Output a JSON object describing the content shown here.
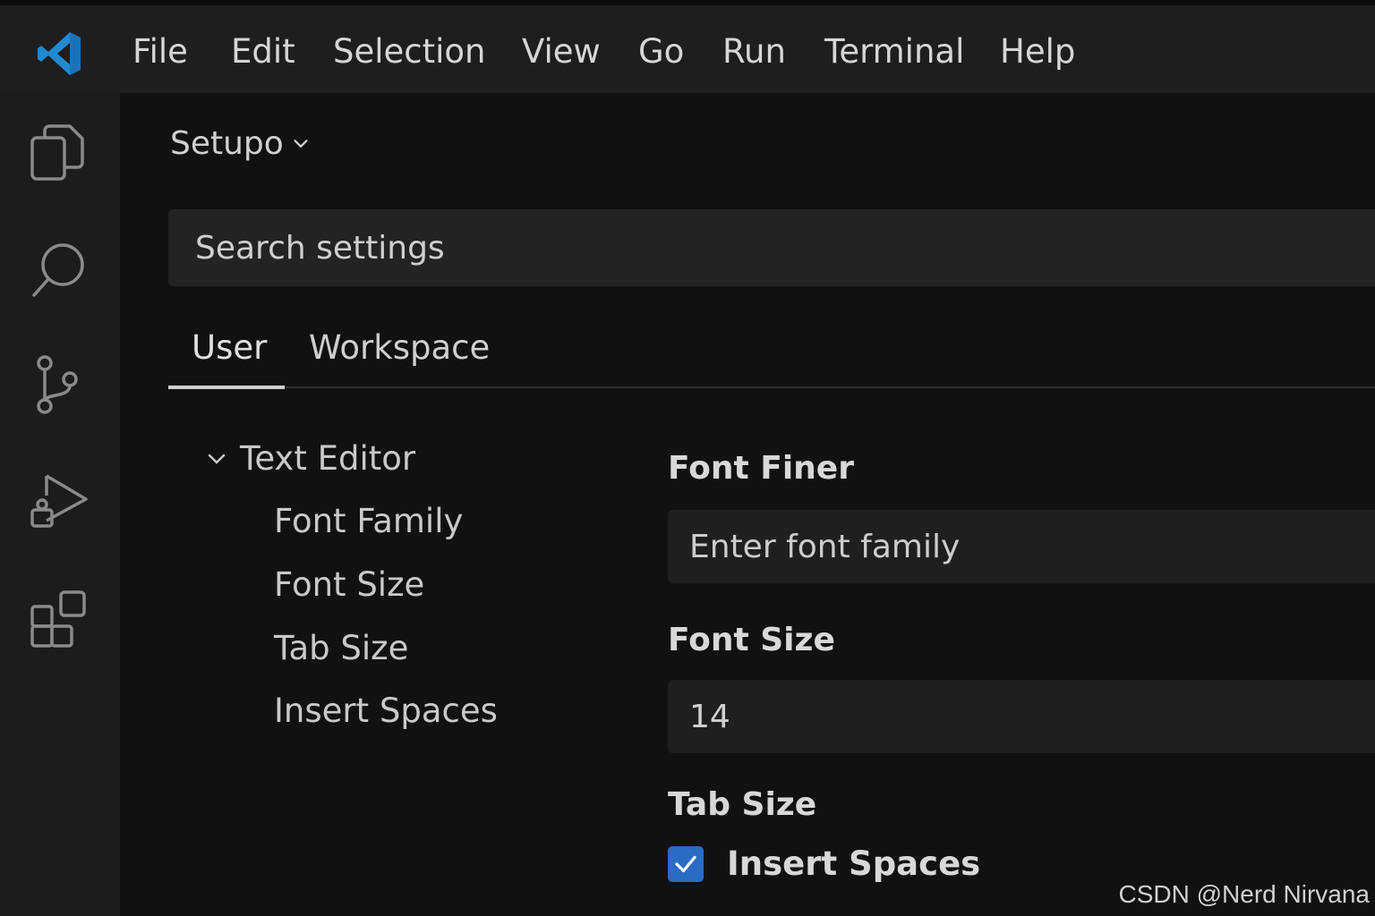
{
  "menubar": {
    "items": [
      "File",
      "Edit",
      "Selection",
      "View",
      "Go",
      "Run",
      "Terminal",
      "Help"
    ]
  },
  "activity_bar": {
    "icons": [
      "explorer-icon",
      "search-icon",
      "source-control-icon",
      "run-debug-icon",
      "extensions-icon"
    ]
  },
  "settings": {
    "profile": "Setupo",
    "search_placeholder": "Search settings",
    "tabs": [
      "User",
      "Workspace"
    ],
    "active_tab": "User",
    "tree": {
      "group": "Text Editor",
      "items": [
        "Font Family",
        "Font Size",
        "Tab Size",
        "Insert Spaces"
      ]
    },
    "font_family": {
      "title": "Font Finer",
      "placeholder": "Enter font family"
    },
    "font_size": {
      "title": "Font Size",
      "value": "14"
    },
    "tab_size": {
      "title": "Tab Size"
    },
    "insert_spaces": {
      "label": "Insert Spaces",
      "checked": true
    }
  },
  "watermark": "CSDN @Nerd Nirvana",
  "colors": {
    "accent": "#2a6bc6",
    "logo": "#1f8ad2",
    "background": "#111113",
    "menubar": "#1e1e20"
  }
}
